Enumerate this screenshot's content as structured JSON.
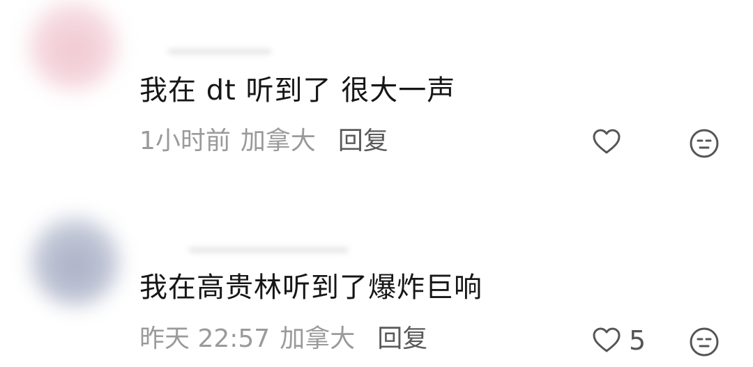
{
  "comments": [
    {
      "text": "我在 dt 听到了 很大一声",
      "time": "1小时前",
      "location": "加拿大",
      "reply_label": "回复",
      "like_count": "",
      "like_icon": "heart-outline-icon",
      "emoji_icon": "neutral-face-icon"
    },
    {
      "text": "我在高贵林听到了爆炸巨响",
      "time": "昨天 22:57",
      "location": "加拿大",
      "reply_label": "回复",
      "like_count": "5",
      "like_icon": "heart-outline-icon",
      "emoji_icon": "neutral-face-icon"
    }
  ],
  "colors": {
    "text": "#161616",
    "meta": "#9a9a9a",
    "reply": "#5a5a5a",
    "icon": "#555555"
  }
}
